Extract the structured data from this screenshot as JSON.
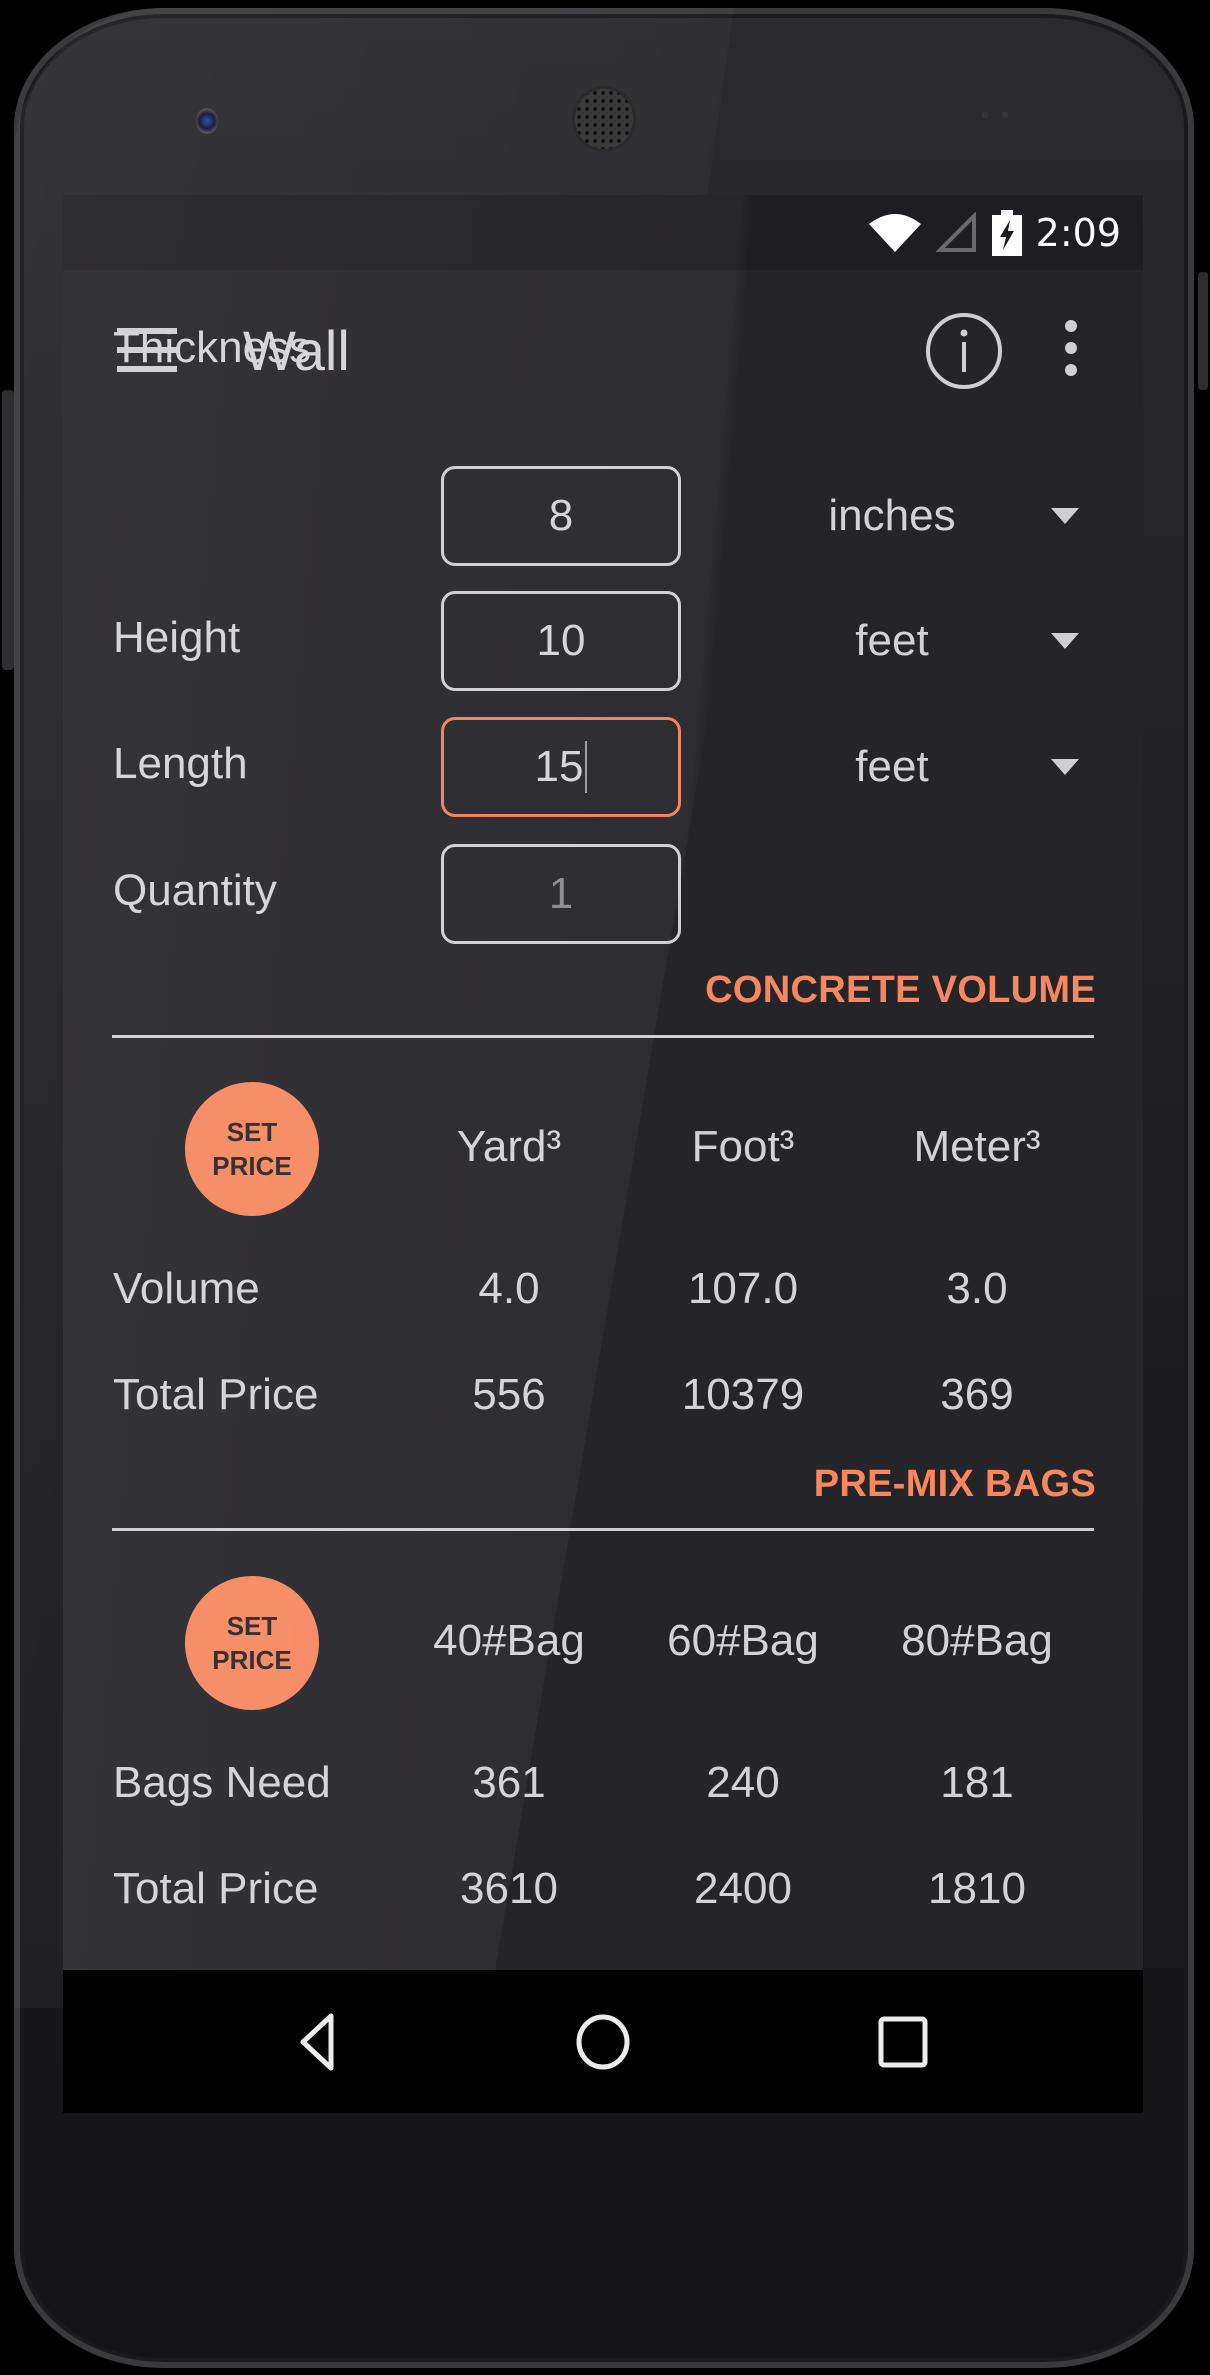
{
  "status_bar": {
    "time": "2:09",
    "icons": [
      "wifi-icon",
      "cellular-signal-icon",
      "battery-charging-icon"
    ]
  },
  "app_bar": {
    "title": "Wall",
    "icons": [
      "menu-icon",
      "info-icon",
      "overflow-menu-icon"
    ]
  },
  "inputs": [
    {
      "label": "Thickness",
      "value": "8",
      "unit": "inches",
      "has_unit": true,
      "focused": false
    },
    {
      "label": "Height",
      "value": "10",
      "unit": "feet",
      "has_unit": true,
      "focused": false
    },
    {
      "label": "Length",
      "value": "15",
      "unit": "feet",
      "has_unit": true,
      "focused": true
    },
    {
      "label": "Quantity",
      "value": "",
      "placeholder": "1",
      "has_unit": false,
      "focused": false
    }
  ],
  "concrete_volume": {
    "section_title": "CONCRETE VOLUME",
    "set_price": {
      "line1": "SET",
      "line2": "PRICE"
    },
    "columns": [
      "Yard³",
      "Foot³",
      "Meter³"
    ],
    "rows": [
      {
        "label": "Volume",
        "values": [
          "4.0",
          "107.0",
          "3.0"
        ]
      },
      {
        "label": "Total Price",
        "values": [
          "556",
          "10379",
          "369"
        ]
      }
    ]
  },
  "premix_bags": {
    "section_title": "PRE-MIX BAGS",
    "set_price": {
      "line1": "SET",
      "line2": "PRICE"
    },
    "columns": [
      "40#Bag",
      "60#Bag",
      "80#Bag"
    ],
    "rows": [
      {
        "label": "Bags Need",
        "values": [
          "361",
          "240",
          "181"
        ]
      },
      {
        "label": "Total Price",
        "values": [
          "3610",
          "2400",
          "1810"
        ]
      }
    ]
  },
  "nav_bar": {
    "buttons": [
      "back-icon",
      "home-icon",
      "recents-icon"
    ]
  },
  "colors": {
    "accent": "#f6875f",
    "background": "#252429",
    "text": "#d3d3d6",
    "focused_border": "#f0805c"
  }
}
